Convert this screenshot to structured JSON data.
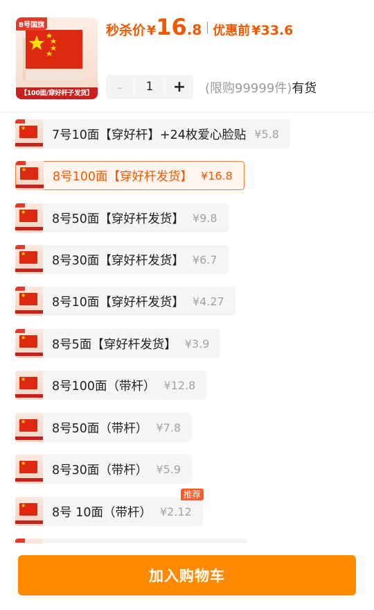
{
  "product": {
    "image_tag": "8号国旗",
    "image_banner": "【100面/穿好杆子发货】",
    "flash_label": "秒杀价",
    "yen": "¥",
    "price_int": "16",
    "price_dec": ".8",
    "orig_label": "优惠前",
    "orig_price": "¥33.6"
  },
  "quantity": {
    "minus": "-",
    "value": "1",
    "plus": "+",
    "limit": "(限购99999件)",
    "availability": "有货"
  },
  "skus": [
    {
      "name": "7号10面【穿好杆】+24枚爱心脸贴",
      "price": "¥5.8",
      "selected": false
    },
    {
      "name": "8号100面【穿好杆发货】",
      "price": "¥16.8",
      "selected": true
    },
    {
      "name": "8号50面【穿好杆发货】",
      "price": "¥9.8",
      "selected": false
    },
    {
      "name": "8号30面【穿好杆发货】",
      "price": "¥6.7",
      "selected": false
    },
    {
      "name": "8号10面【穿好杆发货】",
      "price": "¥4.27",
      "selected": false
    },
    {
      "name": "8号5面【穿好杆发货】",
      "price": "¥3.9",
      "selected": false
    },
    {
      "name": "8号100面（带杆）",
      "price": "¥12.8",
      "selected": false
    },
    {
      "name": "8号50面（带杆）",
      "price": "¥7.8",
      "selected": false
    },
    {
      "name": "8号30面（带杆）",
      "price": "¥5.9",
      "selected": false
    },
    {
      "name": "8号 10面（带杆）",
      "price": "¥2.12",
      "selected": false,
      "badge": "推荐"
    }
  ],
  "cart_button": "加入购物车",
  "colors": {
    "accent": "#ef5a00",
    "button": "#ff8a00",
    "flag_red": "#de2910"
  }
}
